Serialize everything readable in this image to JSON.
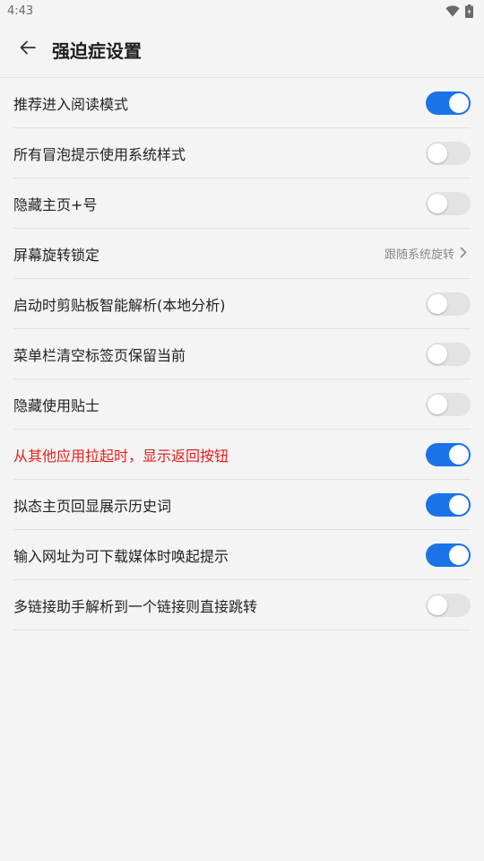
{
  "status_bar": {
    "time": "4:43",
    "icons": [
      "wifi-icon",
      "battery-icon"
    ]
  },
  "header": {
    "title": "强迫症设置",
    "back_icon": "arrow-left-icon"
  },
  "colors": {
    "accent": "#1a73e8",
    "warning_text": "#e0201e",
    "toggle_off": "#e3e3e3",
    "background": "#f4f4f4"
  },
  "settings": [
    {
      "label": "推荐进入阅读模式",
      "type": "toggle",
      "on": true
    },
    {
      "label": "所有冒泡提示使用系统样式",
      "type": "toggle",
      "on": false
    },
    {
      "label": "隐藏主页+号",
      "type": "toggle",
      "on": false
    },
    {
      "label": "屏幕旋转锁定",
      "type": "select",
      "value": "跟随系统旋转",
      "icon": "chevron-right-icon"
    },
    {
      "label": "启动时剪贴板智能解析(本地分析)",
      "type": "toggle",
      "on": false
    },
    {
      "label": "菜单栏清空标签页保留当前",
      "type": "toggle",
      "on": false
    },
    {
      "label": "隐藏使用贴士",
      "type": "toggle",
      "on": false
    },
    {
      "label": "从其他应用拉起时，显示返回按钮",
      "type": "toggle",
      "on": true,
      "warning": true
    },
    {
      "label": "拟态主页回显展示历史词",
      "type": "toggle",
      "on": true
    },
    {
      "label": "输入网址为可下载媒体时唤起提示",
      "type": "toggle",
      "on": true
    },
    {
      "label": "多链接助手解析到一个链接则直接跳转",
      "type": "toggle",
      "on": false
    }
  ]
}
